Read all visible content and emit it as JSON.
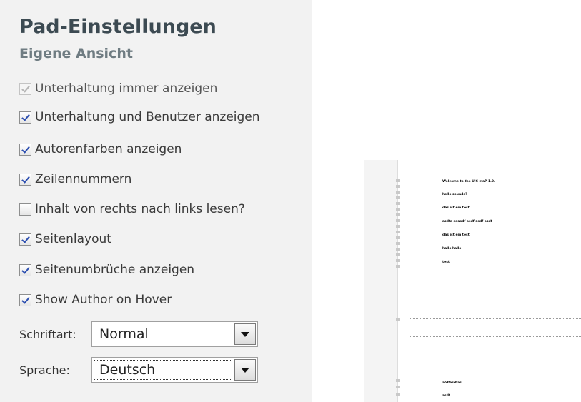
{
  "settings": {
    "title": "Pad-Einstellungen",
    "subtitle": "Eigene Ansicht",
    "options": [
      {
        "label": "Unterhaltung immer anzeigen",
        "checked": true,
        "disabled": true
      },
      {
        "label": "Unterhaltung und Benutzer anzeigen",
        "checked": true,
        "disabled": false
      },
      {
        "label": "Autorenfarben anzeigen",
        "checked": true,
        "disabled": false
      },
      {
        "label": "Zeilennummern",
        "checked": true,
        "disabled": false
      },
      {
        "label": "Inhalt von rechts nach links lesen?",
        "checked": false,
        "disabled": false
      },
      {
        "label": "Seitenlayout",
        "checked": true,
        "disabled": false
      },
      {
        "label": "Seitenumbrüche anzeigen",
        "checked": true,
        "disabled": false
      },
      {
        "label": "Show Author on Hover",
        "checked": true,
        "disabled": false
      }
    ],
    "font_label": "Schriftart:",
    "font_value": "Normal",
    "language_label": "Sprache:",
    "language_value": "Deutsch"
  },
  "pad": {
    "lines": [
      "Welcome to the UIC maP 1.0.",
      "hello sounds?",
      "das ist ein test",
      "asdfa sdasdf asdf asdf asdf",
      "das ist ein test",
      "hallo hallo",
      "test"
    ],
    "lines_after_break": [
      "afdfasdfas",
      "asdf"
    ]
  }
}
